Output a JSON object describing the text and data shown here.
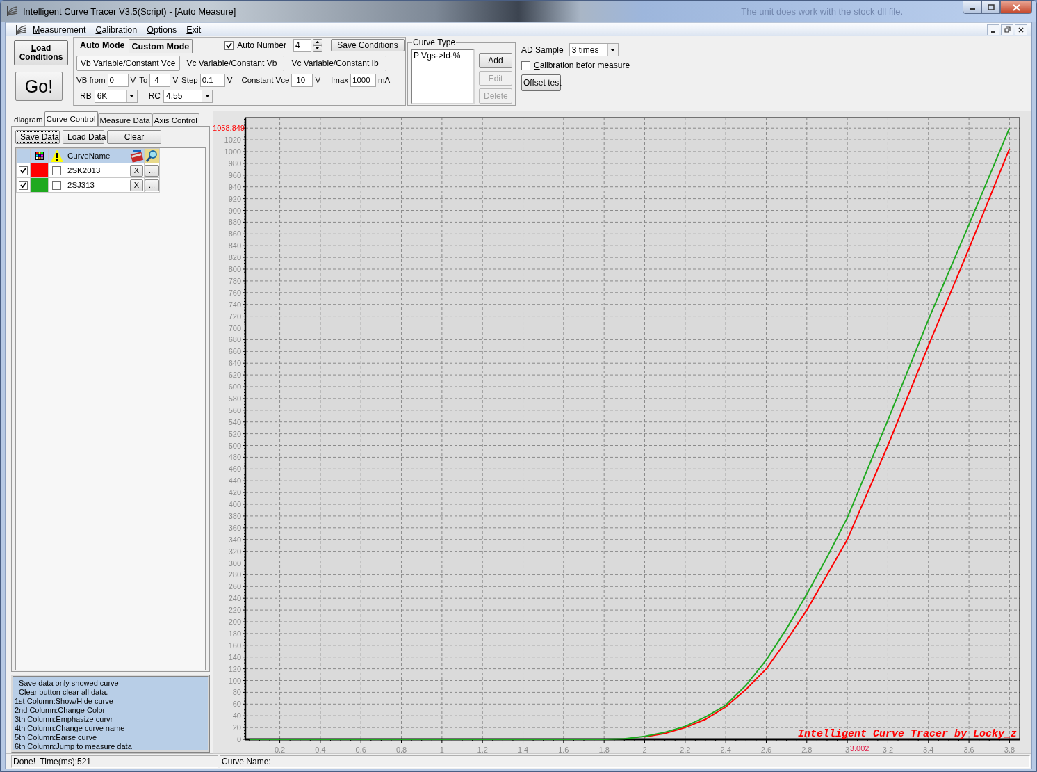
{
  "window": {
    "title": "Intelligent Curve Tracer V3.5(Script) - [Auto Measure]",
    "background_text": "The unit does work with the stock dll file."
  },
  "menu": [
    {
      "label": "Measurement"
    },
    {
      "label": "Calibration"
    },
    {
      "label": "Options"
    },
    {
      "label": "Exit"
    }
  ],
  "toolbar": {
    "load_button": "Load Conditions",
    "go_button": "Go!",
    "mode_tabs": [
      {
        "label": "Auto Mode",
        "selected": true
      },
      {
        "label": "Custom Mode",
        "selected": false
      }
    ],
    "auto_number": {
      "label": "Auto Number",
      "checked": true,
      "value": "4"
    },
    "save_conditions": "Save Conditions",
    "sweep_types": [
      {
        "label": "Vb Variable/Constant Vce",
        "selected": true
      },
      {
        "label": "Vc Variable/Constant Vb",
        "selected": false
      },
      {
        "label": "Vc Variable/Constant Ib",
        "selected": false
      }
    ],
    "fields": [
      {
        "label": "VB from",
        "value": "0",
        "unit": "V"
      },
      {
        "label": "To",
        "value": "-4",
        "unit": "V"
      },
      {
        "label": "Step",
        "value": "0.1",
        "unit": "V"
      },
      {
        "label": "Constant Vce",
        "value": "-10",
        "unit": "V"
      },
      {
        "label": "Imax",
        "value": "1000",
        "unit": "mA"
      }
    ],
    "dropdowns": [
      {
        "label": "RB",
        "value": "6K"
      },
      {
        "label": "RC",
        "value": "4.55"
      }
    ],
    "curve_type": {
      "title": "Curve Type",
      "items": [
        "P Vgs->Id-%"
      ],
      "buttons": [
        {
          "label": "Add",
          "disabled": false
        },
        {
          "label": "Edit",
          "disabled": true
        },
        {
          "label": "Delete",
          "disabled": true
        }
      ]
    },
    "ad_sample": {
      "label": "AD Sample",
      "value": "3 times"
    },
    "calibration": {
      "label": "Calibration befor measure",
      "checked": false
    },
    "offset_button": "Offset test"
  },
  "panel_tabs": [
    {
      "label": "diagram",
      "selected": false
    },
    {
      "label": "Curve Control",
      "selected": true
    },
    {
      "label": "Measure Data",
      "selected": false
    },
    {
      "label": "Axis Control",
      "selected": false
    }
  ],
  "data_buttons": [
    {
      "label": "Save Data",
      "focused": true
    },
    {
      "label": "Load Data",
      "focused": false
    },
    {
      "label": "Clear",
      "focused": false
    }
  ],
  "curve_table": {
    "column_4": "CurveName",
    "rows": [
      {
        "visible": true,
        "color": "#ff0000",
        "emphasized": false,
        "name": "2SK2013",
        "erase": "X",
        "jump": "..."
      },
      {
        "visible": true,
        "color": "#1fa91f",
        "emphasized": false,
        "name": "2SJ313",
        "erase": "X",
        "jump": "..."
      }
    ]
  },
  "help_text": [
    "Save data only showed curve",
    "Clear button clear all data.",
    "1st Column:Show/Hide curve",
    "2nd Column:Change Color",
    "3th Column:Emphasize curvr",
    "4th Column:Change curve name",
    "5th Column:Earse curve",
    "6th Column:Jump to measure data"
  ],
  "chart": {
    "chart_data": {
      "type": "line",
      "x": [
        0.05,
        1.8,
        1.9,
        2.0,
        2.1,
        2.2,
        2.3,
        2.4,
        2.5,
        2.6,
        2.7,
        2.8,
        2.9,
        3.0,
        3.2,
        3.4,
        3.6,
        3.8
      ],
      "series": [
        {
          "color": "#ff0000",
          "values": [
            null,
            null,
            null,
            4,
            10,
            20,
            34,
            55,
            85,
            120,
            168,
            220,
            280,
            340,
            500,
            670,
            835,
            1005
          ]
        },
        {
          "color": "#1fa91f",
          "values": [
            0,
            0,
            1,
            5,
            12,
            22,
            38,
            58,
            92,
            135,
            188,
            247,
            310,
            377,
            543,
            714,
            876,
            1040
          ]
        }
      ],
      "xlim": [
        0.03,
        3.85
      ],
      "ylim": [
        0,
        1058
      ],
      "xticks": [
        0.2,
        0.4,
        0.6,
        0.8,
        1,
        1.2,
        1.4,
        1.6,
        1.8,
        2,
        2.2,
        2.4,
        2.6,
        2.8,
        3,
        3.2,
        3.4,
        3.6,
        3.8
      ],
      "yticks": [
        0,
        20,
        40,
        60,
        80,
        100,
        120,
        140,
        160,
        180,
        200,
        220,
        240,
        260,
        280,
        300,
        320,
        340,
        360,
        380,
        400,
        420,
        440,
        460,
        480,
        500,
        520,
        540,
        560,
        580,
        600,
        620,
        640,
        660,
        680,
        700,
        720,
        740,
        760,
        780,
        800,
        820,
        840,
        860,
        880,
        900,
        920,
        940,
        960,
        980,
        1000,
        1020
      ],
      "grid": true,
      "annotations": [
        "1058.849",
        "3.002",
        "Intelligent Curve Tracer by Locky_z"
      ]
    }
  },
  "status_bar": [
    "Done!  Time(ms):521",
    "Curve Name:"
  ]
}
